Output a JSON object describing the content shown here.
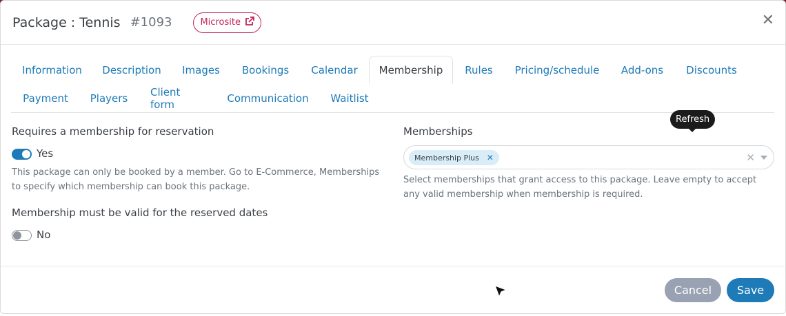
{
  "header": {
    "title": "Package : Tennis",
    "id": "#1093",
    "microsite_label": "Microsite",
    "close_icon": "close-icon"
  },
  "tabs": [
    {
      "label": "Information"
    },
    {
      "label": "Description"
    },
    {
      "label": "Images"
    },
    {
      "label": "Bookings"
    },
    {
      "label": "Calendar"
    },
    {
      "label": "Membership",
      "active": true
    },
    {
      "label": "Rules"
    },
    {
      "label": "Pricing/schedule"
    },
    {
      "label": "Add-ons"
    },
    {
      "label": "Discounts"
    },
    {
      "label": "Payment"
    },
    {
      "label": "Players"
    },
    {
      "label": "Client form"
    },
    {
      "label": "Communication"
    },
    {
      "label": "Waitlist"
    }
  ],
  "left": {
    "requires_label": "Requires a membership for reservation",
    "requires_toggle": {
      "state": "on",
      "text": "Yes"
    },
    "requires_help": "This package can only be booked by a member. Go to E-Commerce, Memberships to specify which membership can book this package.",
    "valid_label": "Membership must be valid for the reserved dates",
    "valid_toggle": {
      "state": "off",
      "text": "No"
    }
  },
  "right": {
    "memberships_label": "Memberships",
    "selected": [
      "Membership Plus"
    ],
    "help": "Select memberships that grant access to this package. Leave empty to accept any valid membership when membership is required.",
    "tooltip": "Refresh"
  },
  "footer": {
    "cancel_label": "Cancel",
    "save_label": "Save"
  },
  "colors": {
    "accent": "#1e7bb8",
    "microsite": "#c0245c",
    "cancel": "#98a2b3"
  }
}
